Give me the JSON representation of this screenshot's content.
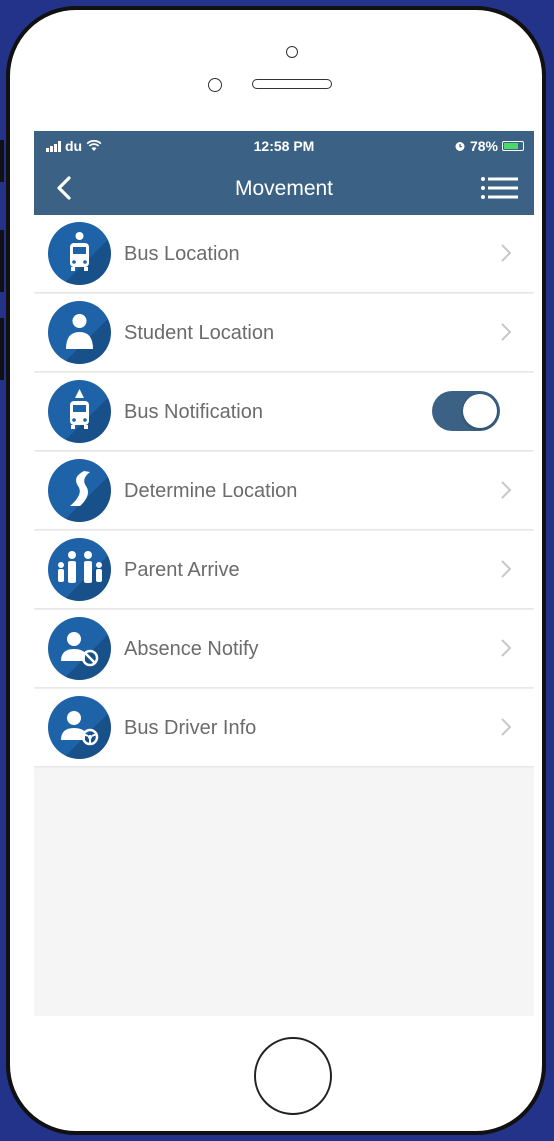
{
  "status_bar": {
    "carrier": "du",
    "time": "12:58 PM",
    "battery": "78%"
  },
  "navbar": {
    "title": "Movement"
  },
  "menu": [
    {
      "label": "Bus Location",
      "icon": "bus-pin-icon",
      "control": "chevron"
    },
    {
      "label": "Student Location",
      "icon": "student-icon",
      "control": "chevron"
    },
    {
      "label": "Bus Notification",
      "icon": "bus-alert-icon",
      "control": "toggle",
      "toggle_on": true
    },
    {
      "label": "Determine Location",
      "icon": "road-icon",
      "control": "chevron"
    },
    {
      "label": "Parent Arrive",
      "icon": "family-icon",
      "control": "chevron"
    },
    {
      "label": "Absence Notify",
      "icon": "user-blocked-icon",
      "control": "chevron"
    },
    {
      "label": "Bus Driver Info",
      "icon": "driver-icon",
      "control": "chevron"
    }
  ],
  "colors": {
    "header": "#3b6184",
    "icon_bg": "#1e62a8",
    "frame_bg": "#23338a"
  }
}
